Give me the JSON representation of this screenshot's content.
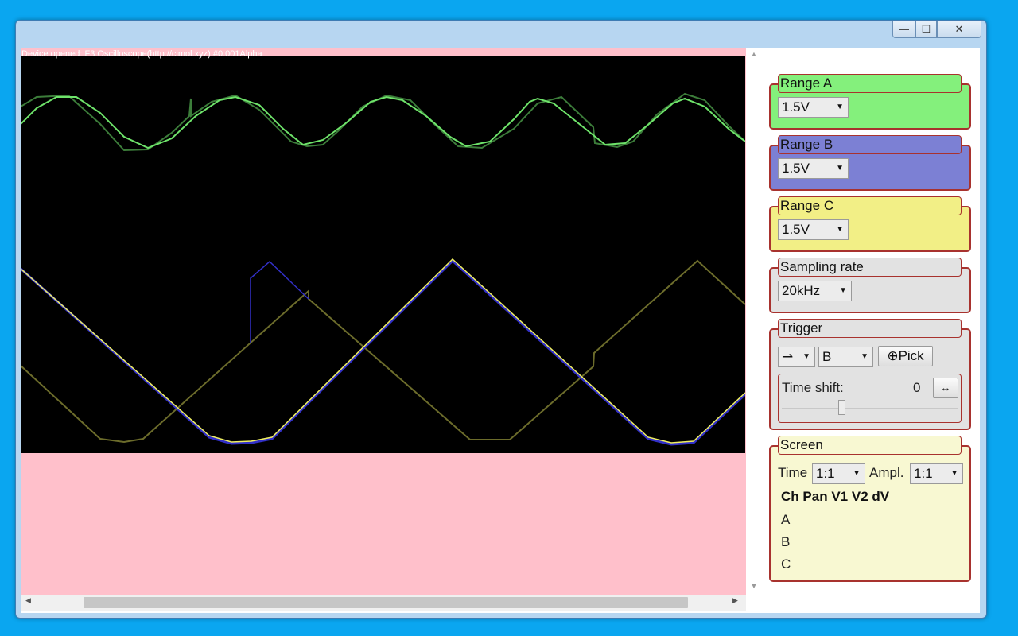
{
  "window": {
    "controls": {
      "minimize": "—",
      "maximize": "☐",
      "close": "✕"
    }
  },
  "status": "Device opened: F3 Oscilloscope(http://cimol.xyz) #0.001Alpha",
  "colors": {
    "channel_a": "#6ee36a",
    "channel_b": "#3230c8",
    "channel_c": "#f0f060",
    "panel_border": "#a8322e",
    "range_a_bg": "#84f07c",
    "range_b_bg": "#7c80d4",
    "range_c_bg": "#f2ef86",
    "neutral_bg": "#e2e2e2",
    "screen_bg": "#f8f8d2",
    "plot_bg": "#000000",
    "page_bg": "#ffc0cb"
  },
  "range_a": {
    "title": "Range A",
    "value": "1.5V"
  },
  "range_b": {
    "title": "Range B",
    "value": "1.5V"
  },
  "range_c": {
    "title": "Range C",
    "value": "1.5V"
  },
  "sampling": {
    "title": "Sampling rate",
    "value": "20kHz"
  },
  "trigger": {
    "title": "Trigger",
    "edge_value": "⇀",
    "channel_value": "B",
    "pick_label": "Pick",
    "pick_icon": "⊕",
    "time_shift_label": "Time shift:",
    "time_shift_value": "0",
    "reset_icon": "↔"
  },
  "screen": {
    "title": "Screen",
    "time_label": "Time",
    "time_value": "1:1",
    "ampl_label": "Ampl.",
    "ampl_value": "1:1",
    "columns": [
      "Ch",
      "Pan",
      "V1",
      "V2",
      "dV"
    ],
    "rows": [
      "A",
      "B",
      "C"
    ]
  },
  "scrollbars": {
    "up": "▲",
    "down": "▼",
    "left": "◀",
    "right": "▶"
  }
}
